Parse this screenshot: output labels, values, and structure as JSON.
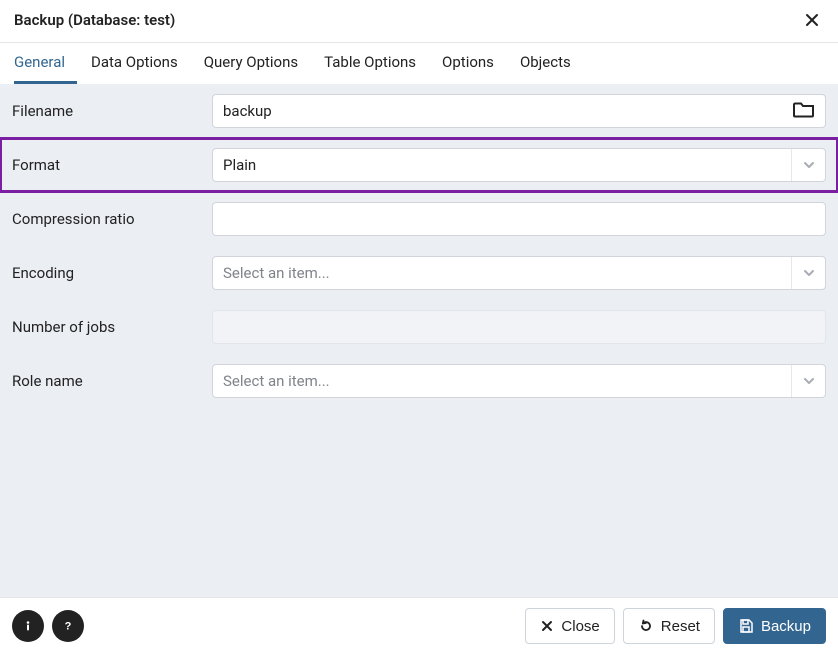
{
  "header": {
    "title": "Backup (Database: test)"
  },
  "tabs": [
    {
      "label": "General",
      "active": true
    },
    {
      "label": "Data Options"
    },
    {
      "label": "Query Options"
    },
    {
      "label": "Table Options"
    },
    {
      "label": "Options"
    },
    {
      "label": "Objects"
    }
  ],
  "form": {
    "filename": {
      "label": "Filename",
      "value": "backup"
    },
    "format": {
      "label": "Format",
      "value": "Plain"
    },
    "compression": {
      "label": "Compression ratio",
      "value": ""
    },
    "encoding": {
      "label": "Encoding",
      "placeholder": "Select an item..."
    },
    "jobs": {
      "label": "Number of jobs"
    },
    "rolename": {
      "label": "Role name",
      "placeholder": "Select an item..."
    }
  },
  "footer": {
    "close": "Close",
    "reset": "Reset",
    "backup": "Backup"
  }
}
